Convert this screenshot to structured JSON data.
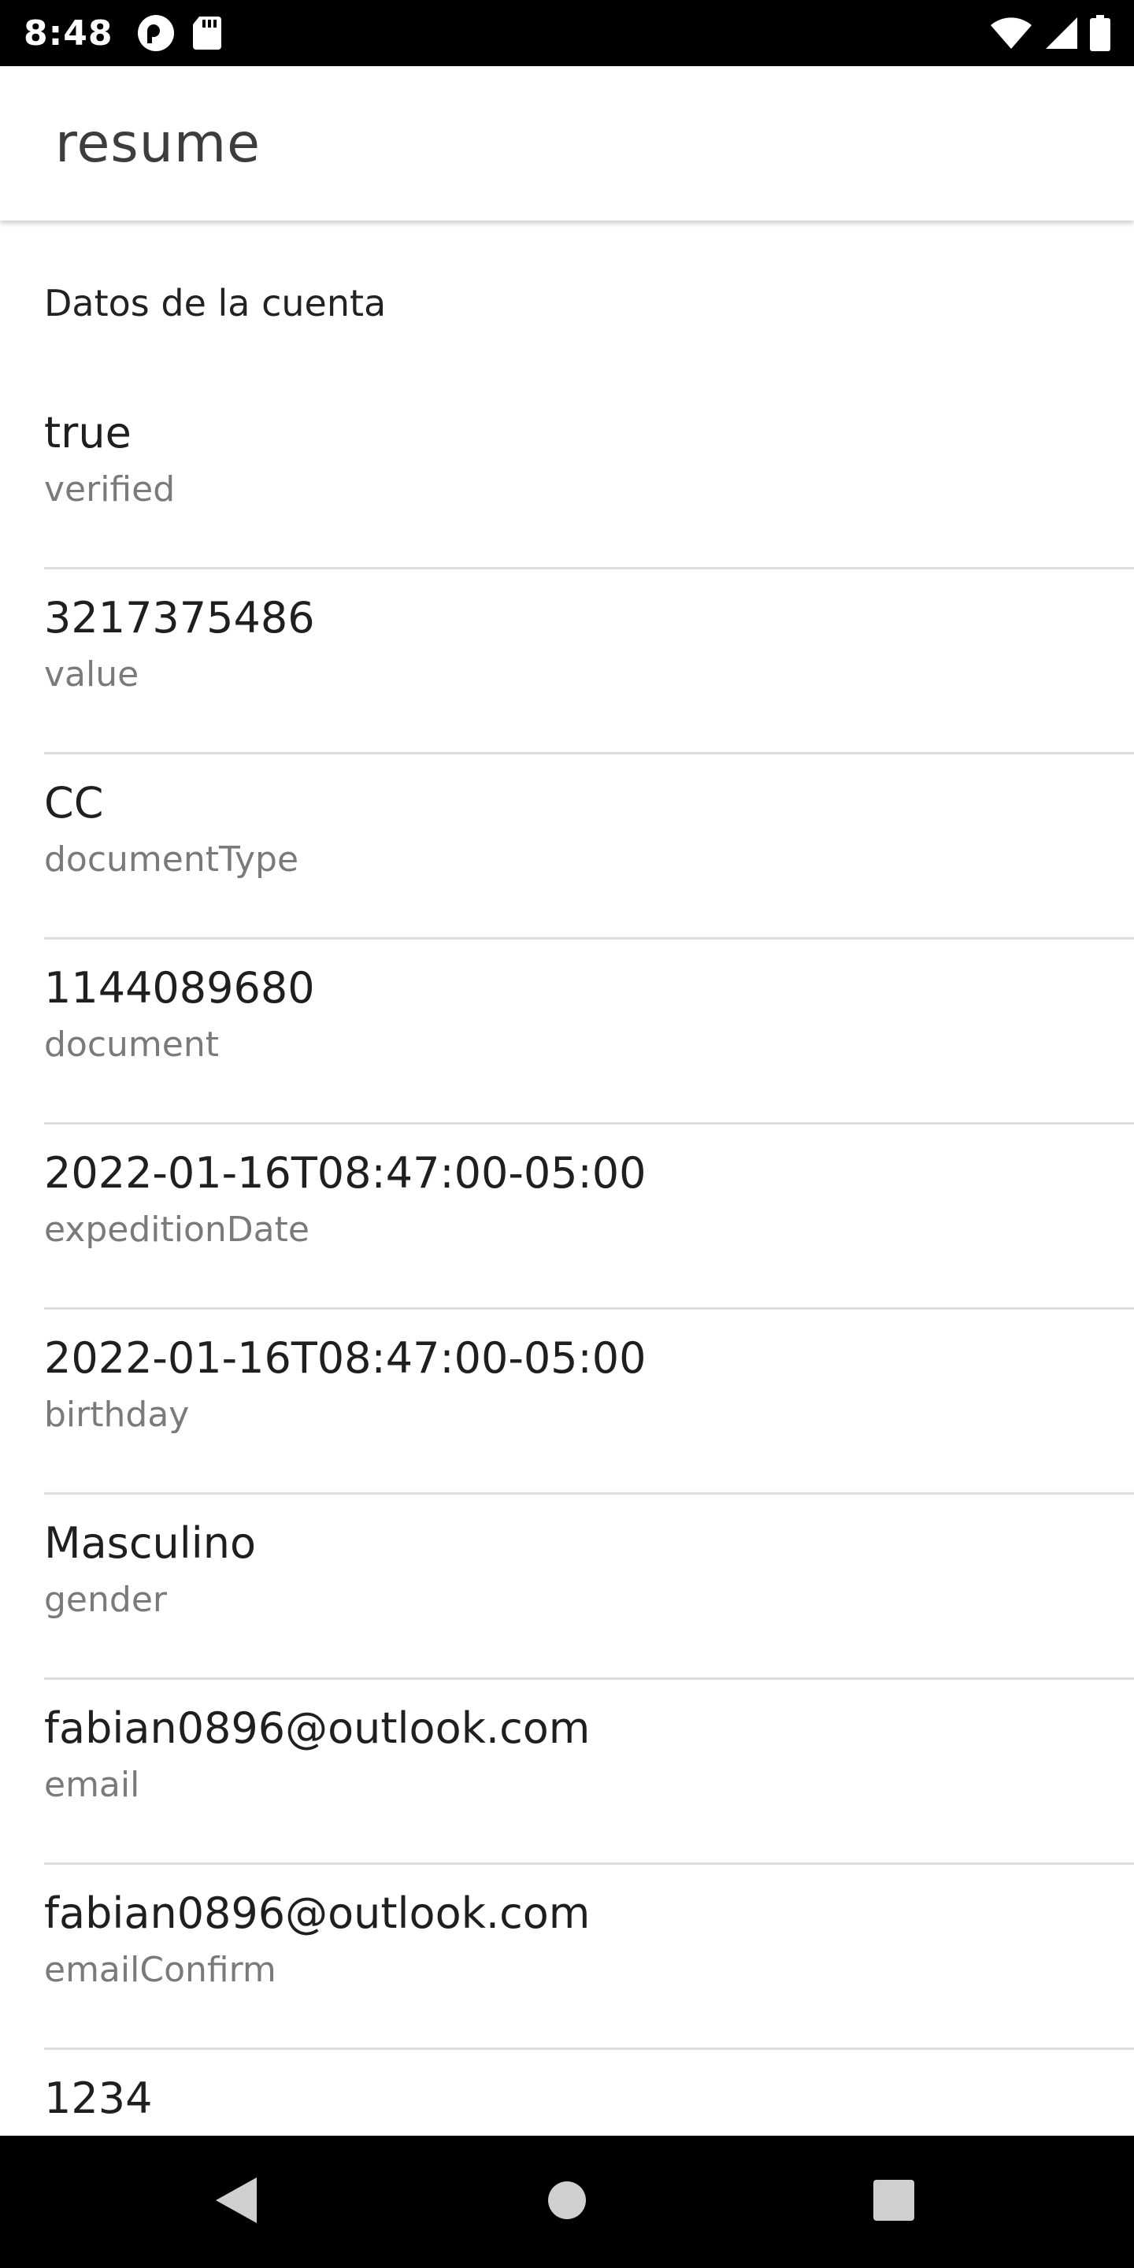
{
  "status_bar": {
    "time": "8:48",
    "left_icons": [
      "app-notification-icon",
      "sd-card-icon"
    ],
    "right_icons": [
      "wifi-icon",
      "cellular-signal-icon",
      "battery-icon"
    ]
  },
  "app_bar": {
    "title": "resume"
  },
  "section": {
    "title": "Datos de la cuenta"
  },
  "items": [
    {
      "value": "true",
      "label": "verified"
    },
    {
      "value": "3217375486",
      "label": "value"
    },
    {
      "value": "CC",
      "label": "documentType"
    },
    {
      "value": "1144089680",
      "label": "document"
    },
    {
      "value": "2022-01-16T08:47:00-05:00",
      "label": "expeditionDate"
    },
    {
      "value": "2022-01-16T08:47:00-05:00",
      "label": "birthday"
    },
    {
      "value": "Masculino",
      "label": "gender"
    },
    {
      "value": "fabian0896@outlook.com",
      "label": "email"
    },
    {
      "value": "fabian0896@outlook.com",
      "label": "emailConfirm"
    },
    {
      "value": "1234",
      "label": ""
    }
  ],
  "nav_bar": {
    "buttons": [
      "back-icon",
      "home-icon",
      "recents-icon"
    ]
  },
  "colors": {
    "status_bar_bg": "#000000",
    "app_bar_bg": "#ffffff",
    "primary_text": "#1f1f1f",
    "secondary_text": "#7a7a7a",
    "divider": "#dedede"
  }
}
